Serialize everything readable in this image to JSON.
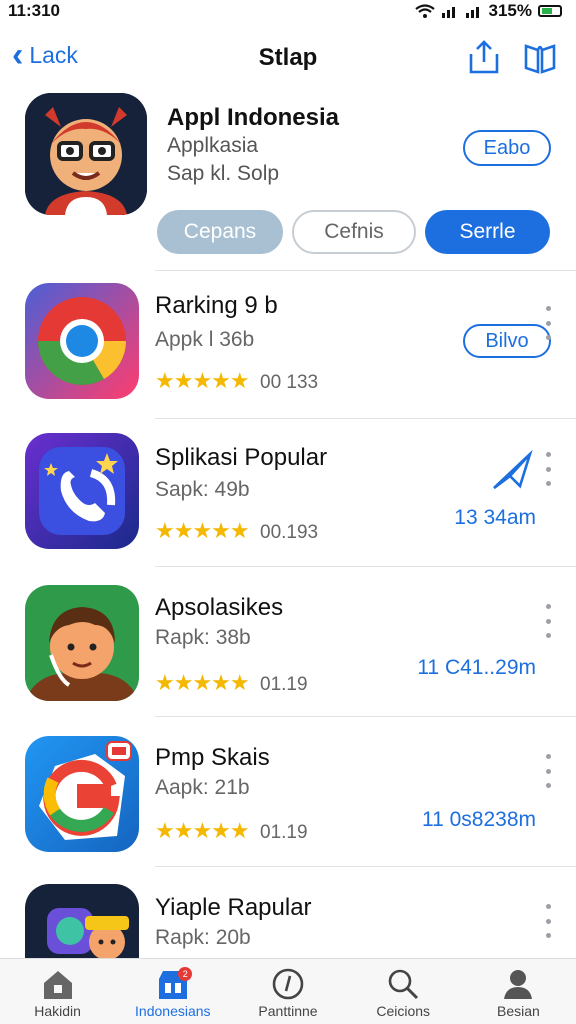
{
  "status_bar": {
    "time": "11:310",
    "battery": "315%"
  },
  "nav": {
    "back_label": "Lack",
    "title": "Stlap"
  },
  "featured": {
    "title": "Appl Indonesia",
    "subtitle": "Applkasia",
    "meta": "Sap kl. Solp",
    "get_button": "Eabo",
    "segments": [
      "Cepans",
      "Cefnis",
      "Serrle"
    ]
  },
  "apps": [
    {
      "name": "Rarking 9 b",
      "size": "Appk l 36b",
      "rating": "00 133",
      "action_button": "Bilvo",
      "link": ""
    },
    {
      "name": "Splikasi Popular",
      "size": "Sapk: 49b",
      "rating": "00.193",
      "action_button": "",
      "link": "13 34am"
    },
    {
      "name": "Apsolasikes",
      "size": "Rapk: 38b",
      "rating": "01.19",
      "action_button": "",
      "link": "11 C41..29m"
    },
    {
      "name": "Pmp Skais",
      "size": "Aapk: 21b",
      "rating": "01.19",
      "action_button": "",
      "link": "11 0s8238m"
    },
    {
      "name": "Yiaple Rapular",
      "size": "Rapk: 20b",
      "rating": "",
      "action_button": "",
      "link": ""
    }
  ],
  "stars": "★★★★★",
  "tabs": [
    {
      "label": "Hakidin",
      "icon": "home-icon"
    },
    {
      "label": "Indonesians",
      "icon": "store-icon",
      "badge": "2"
    },
    {
      "label": "Panttinne",
      "icon": "clock-icon"
    },
    {
      "label": "Ceicions",
      "icon": "search-icon"
    },
    {
      "label": "Besian",
      "icon": "person-icon"
    }
  ],
  "colors": {
    "accent": "#1d6fe0",
    "star": "#f5b800",
    "muted_button": "#a9c0d3"
  }
}
